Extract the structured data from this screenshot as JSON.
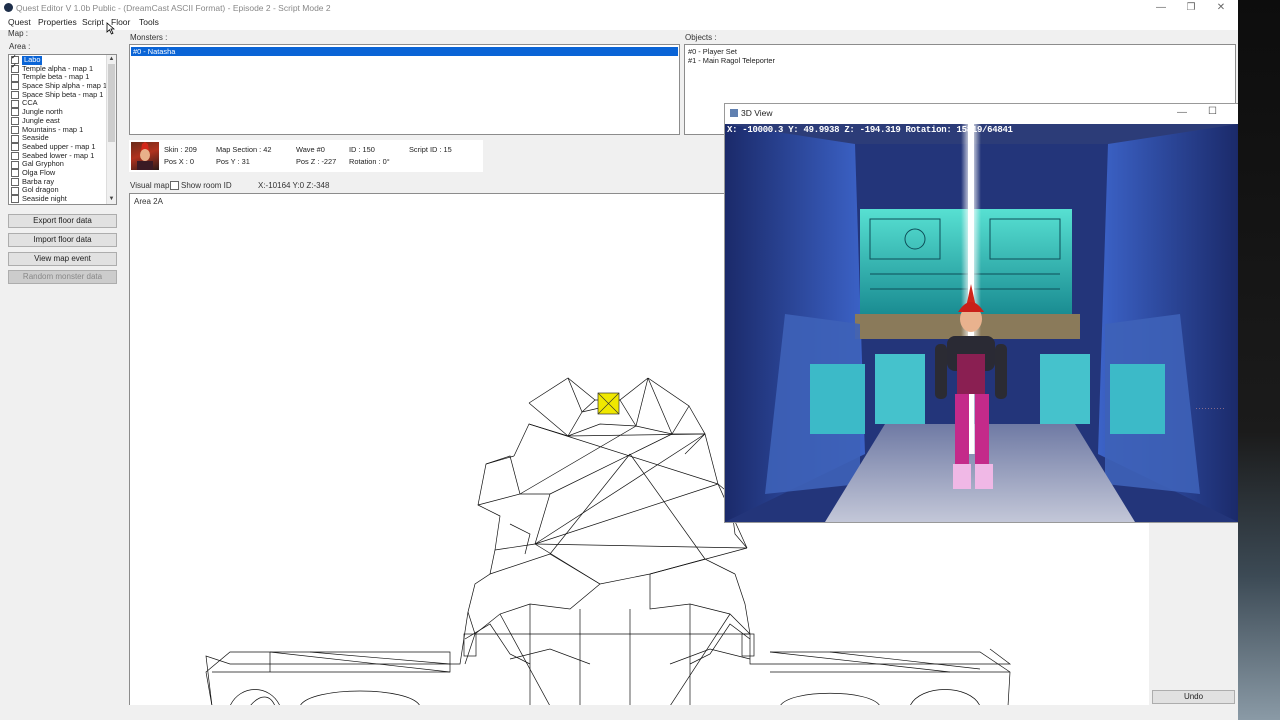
{
  "window": {
    "title": "Quest Editor V 1.0b Public -  (DreamCast ASCII Format) - Episode 2 - Script Mode 2",
    "minimize": "—",
    "maximize": "❐",
    "close": "✕"
  },
  "menu": [
    "Quest",
    "Properties",
    "Script",
    "Floor",
    "Tools"
  ],
  "left": {
    "map_label": "Map :",
    "area_label": "Area :",
    "areas": [
      {
        "label": "Labo",
        "checked": true,
        "selected": true
      },
      {
        "label": "Temple alpha - map 1",
        "checked": true,
        "selected": false
      },
      {
        "label": "Temple beta - map 1",
        "checked": false,
        "selected": false
      },
      {
        "label": "Space Ship alpha - map 1",
        "checked": false,
        "selected": false
      },
      {
        "label": "Space Ship beta - map 1",
        "checked": false,
        "selected": false
      },
      {
        "label": "CCA",
        "checked": false,
        "selected": false
      },
      {
        "label": "Jungle north",
        "checked": false,
        "selected": false
      },
      {
        "label": "Jungle east",
        "checked": false,
        "selected": false
      },
      {
        "label": "Mountains - map 1",
        "checked": false,
        "selected": false
      },
      {
        "label": "Seaside",
        "checked": false,
        "selected": false
      },
      {
        "label": "Seabed upper - map 1",
        "checked": false,
        "selected": false
      },
      {
        "label": "Seabed lower - map 1",
        "checked": false,
        "selected": false
      },
      {
        "label": "Gal Gryphon",
        "checked": false,
        "selected": false
      },
      {
        "label": "Olga Flow",
        "checked": false,
        "selected": false
      },
      {
        "label": "Barba ray",
        "checked": false,
        "selected": false
      },
      {
        "label": "Gol dragon",
        "checked": false,
        "selected": false
      },
      {
        "label": "Seaside night",
        "checked": false,
        "selected": false
      }
    ],
    "buttons": {
      "export": "Export floor data",
      "import": "Import floor data",
      "view_event": "View map event",
      "random": "Random monster data"
    }
  },
  "monsters": {
    "label": "Monsters :",
    "items": [
      "#0 - Natasha"
    ]
  },
  "objects": {
    "label": "Objects :",
    "items": [
      "#0 - Player Set",
      "#1 - Main Ragol Teleporter"
    ]
  },
  "info": {
    "skin": "Skin : 209",
    "map_section": "Map Section : 42",
    "wave": "Wave #0",
    "id": "ID : 150",
    "script_id": "Script ID : 15",
    "pos_x": "Pos X : 0",
    "pos_y": "Pos Y : 31",
    "pos_z": "Pos Z : -227",
    "rotation": "Rotation : 0°"
  },
  "visual_map": {
    "label": "Visual map",
    "show_room_id": "Show room ID",
    "coords": "X:-10164  Y:0  Z:-348",
    "area_name": "Area 2A"
  },
  "view3d": {
    "title": "3D View",
    "coords": "X: -10000.3  Y: 49.9938  Z: -194.319  Rotation: 15819/64841"
  },
  "undo": "Undo",
  "colors": {
    "selection": "#0a64d6",
    "marker": "#f0e800"
  }
}
